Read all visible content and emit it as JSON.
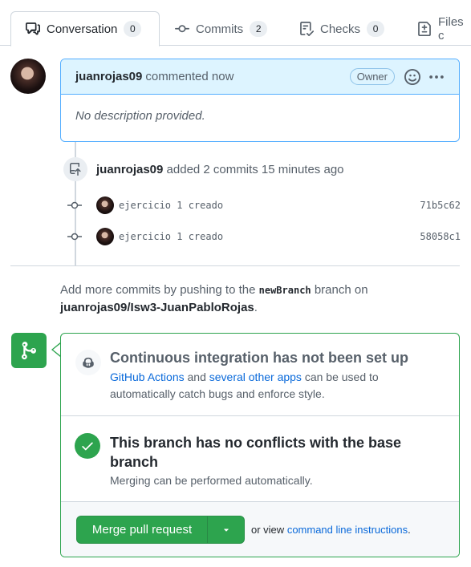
{
  "tabs": [
    {
      "label": "Conversation",
      "count": "0",
      "icon": "comment-discussion-icon",
      "active": true
    },
    {
      "label": "Commits",
      "count": "2",
      "icon": "git-commit-icon"
    },
    {
      "label": "Checks",
      "count": "0",
      "icon": "checklist-icon"
    },
    {
      "label": "Files c",
      "icon": "file-diff-icon"
    }
  ],
  "comment": {
    "author": "juanrojas09",
    "meta": "commented now",
    "badge": "Owner",
    "body": "No description provided."
  },
  "event": {
    "author": "juanrojas09",
    "text": "added 2 commits 15 minutes ago"
  },
  "commits": [
    {
      "message": "ejercicio 1 creado",
      "sha": "71b5c62"
    },
    {
      "message": "ejercicio 1 creado",
      "sha": "58058c1"
    }
  ],
  "hint": {
    "prefix": "Add more commits by pushing to the",
    "branch": "newBranch",
    "middle": "branch on",
    "repo": "juanrojas09/Isw3-JuanPabloRojas",
    "suffix": "."
  },
  "ci": {
    "title": "Continuous integration has not been set up",
    "link1": "GitHub Actions",
    "and": "and",
    "link2": "several other apps",
    "rest": "can be used to automatically catch bugs and enforce style."
  },
  "conflicts": {
    "title": "This branch has no conflicts with the base branch",
    "desc": "Merging can be performed automatically."
  },
  "merge": {
    "button": "Merge pull request",
    "alt_prefix": "or view",
    "alt_link": "command line instructions",
    "alt_suffix": "."
  },
  "colors": {
    "accent_green": "#2da44e",
    "link_blue": "#0969da",
    "comment_header": "#ddf4ff"
  }
}
